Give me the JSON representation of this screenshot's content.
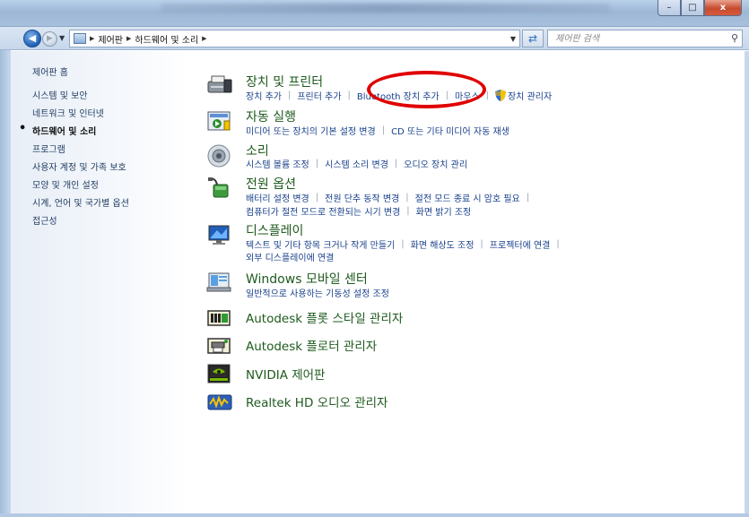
{
  "window": {
    "controls": {
      "minimize": "–",
      "maximize": "□",
      "close": "x"
    }
  },
  "address_bar": {
    "crumbs": [
      "제어판",
      "하드웨어 및 소리"
    ],
    "search_placeholder": "제어판 검색"
  },
  "left_pane": {
    "home": "제어판 홈",
    "items": [
      {
        "label": "시스템 및 보안",
        "current": false
      },
      {
        "label": "네트워크 및 인터넷",
        "current": false
      },
      {
        "label": "하드웨어 및 소리",
        "current": true
      },
      {
        "label": "프로그램",
        "current": false
      },
      {
        "label": "사용자 계정 및 가족 보호",
        "current": false
      },
      {
        "label": "모양 및 개인 설정",
        "current": false
      },
      {
        "label": "시계, 언어 및 국가별 옵션",
        "current": false
      },
      {
        "label": "접근성",
        "current": false
      }
    ]
  },
  "categories": {
    "devices": {
      "title": "장치 및 프린터",
      "links": [
        "장치 추가",
        "프린터 추가",
        "Bluetooth 장치 추가",
        "마우스",
        "장치 관리자"
      ]
    },
    "autoplay": {
      "title": "자동 실행",
      "links": [
        "미디어 또는 장치의 기본 설정 변경",
        "CD 또는 기타 미디어 자동 재생"
      ]
    },
    "sound": {
      "title": "소리",
      "links": [
        "시스템 볼륨 조정",
        "시스템 소리 변경",
        "오디오 장치 관리"
      ]
    },
    "power": {
      "title": "전원 옵션",
      "links_row1": [
        "배터리 설정 변경",
        "전원 단추 동작 변경",
        "절전 모드 종료 시 암호 필요"
      ],
      "links_row2": [
        "컴퓨터가 절전 모드로 전환되는 시기 변경",
        "화면 밝기 조정"
      ]
    },
    "display": {
      "title": "디스플레이",
      "links_row1": [
        "텍스트 및 기타 항목 크거나 작게 만들기",
        "화면 해상도 조정",
        "프로젝터에 연결"
      ],
      "links_row2": [
        "외부 디스플레이에 연결"
      ]
    },
    "mobility": {
      "title": "Windows 모바일 센터",
      "links": [
        "일반적으로 사용하는 기동성 설정 조정"
      ]
    },
    "autodesk_plot": {
      "title": "Autodesk 플롯 스타일 관리자"
    },
    "autodesk_plotter": {
      "title": "Autodesk 플로터 관리자"
    },
    "nvidia": {
      "title": "NVIDIA 제어판"
    },
    "realtek": {
      "title": "Realtek HD 오디오 관리자"
    }
  },
  "colors": {
    "category_title": "#1e5a1e",
    "link": "#173f8a",
    "highlight": "#e00000"
  }
}
